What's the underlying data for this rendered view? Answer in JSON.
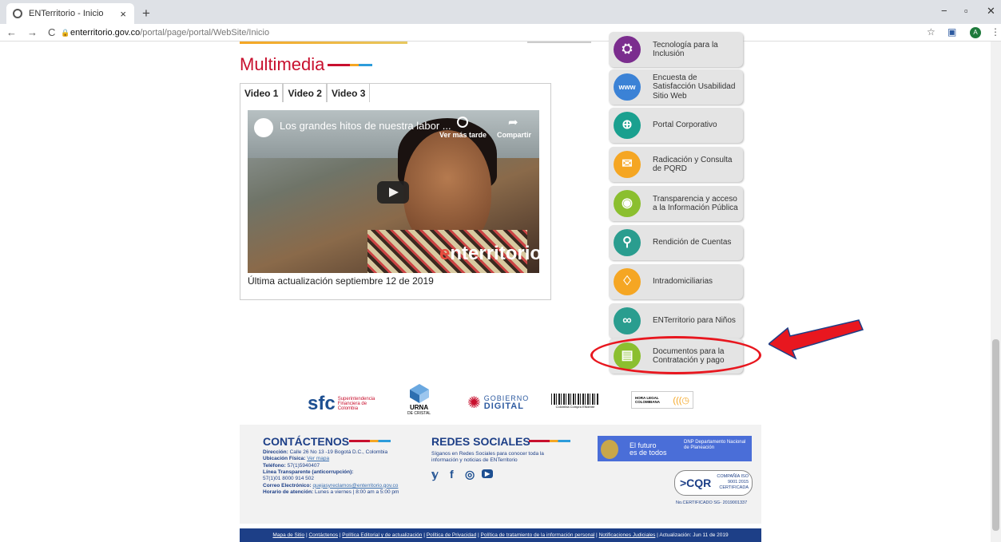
{
  "browser": {
    "tab_title": "ENTerritorio - Inicio",
    "tab_close": "×",
    "new_tab": "+",
    "url_host": "enterritorio.gov.co",
    "url_path": "/portal/page/portal/WebSite/Inicio",
    "profile_initial": "A"
  },
  "multimedia": {
    "title": "Multimedia",
    "tabs": [
      "Video 1",
      "Video 2",
      "Video 3"
    ],
    "video_title": "Los grandes hitos de nuestra labor ...",
    "watch_later": "Ver más tarde",
    "share": "Compartir",
    "brand": "nterritorio",
    "updated": "Última actualización septiembre 12 de 2019"
  },
  "sidebar": {
    "items": [
      {
        "label": "Tecnología para la Inclusión",
        "color": "#7b2d8e",
        "glyph": "⛭"
      },
      {
        "label": "Encuesta de Satisfacción Usabilidad Sitio Web",
        "color": "#3b82d6",
        "glyph": "www"
      },
      {
        "label": "Portal Corporativo",
        "color": "#1aa08f",
        "glyph": "⊕"
      },
      {
        "label": "Radicación y Consulta de PQRD",
        "color": "#f5a623",
        "glyph": "✉"
      },
      {
        "label": "Transparencia y acceso a la Información Pública",
        "color": "#8bbf2f",
        "glyph": "◉"
      },
      {
        "label": "Rendición de Cuentas",
        "color": "#2a9d8f",
        "glyph": "⚲"
      },
      {
        "label": "Intradomiciliarias",
        "color": "#f5a623",
        "glyph": "♢"
      },
      {
        "label": "ENTerritorio para Niños",
        "color": "#2a9d8f",
        "glyph": "∞"
      },
      {
        "label": "Documentos para la Contratación y pago",
        "color": "#8bbf2f",
        "glyph": "▤"
      }
    ]
  },
  "logos": {
    "sfc": "sfc",
    "sfc_sub": "Superintendencia Financiera de Colombia",
    "urna": "URNA",
    "urna_sub": "DE CRISTAL",
    "gobierno": "GOBIERNO",
    "digital": "DIGITAL",
    "compra": "Colombia Compra Eficiente",
    "hora": "HORA LEGAL COLOMBIANA"
  },
  "footer": {
    "contact_title": "CONTÁCTENOS",
    "direccion_label": "Dirección:",
    "direccion": "Calle 26 No 13 -19 Bogotá D.C., Colombia",
    "ubicacion_label": "Ubicación Física:",
    "ubicacion_link": "Ver mapa",
    "telefono_label": "Teléfono:",
    "telefono": "57(1)5940407",
    "linea_label": "Línea Transparente (anticorrupción):",
    "linea": "57(1)01 8000 914 502",
    "correo_label": "Correo Electrónico:",
    "correo": "quejasyreclamos@enterritorio.gov.co",
    "horario_label": "Horario de atención:",
    "horario": "Lunes a viernes | 8:00 am a 5:00 pm",
    "social_title": "REDES SOCIALES",
    "social_text": "Síganos en Redes Sociales para conocer toda la información y noticias de ENTerritorio",
    "gov_line1": "El futuro",
    "gov_line2": "es de todos",
    "dnp": "DNP Departamento Nacional de Planeación",
    "cqr": ">CQR",
    "cqr_small": "COMPAÑÍA ISO 9001:2015 CERTIFICADA",
    "cert": "No.CERTIFICADO SG- 2019001337"
  },
  "bottom_links": [
    "Mapa de Sitio",
    "Contáctenos",
    "Política Editorial y de actualización",
    "Política de Privacidad",
    "Política de tratamiento de la información personal",
    "Notificaciones Judiciales"
  ],
  "bottom_update": "Actualización: Jun 11 de 2019"
}
